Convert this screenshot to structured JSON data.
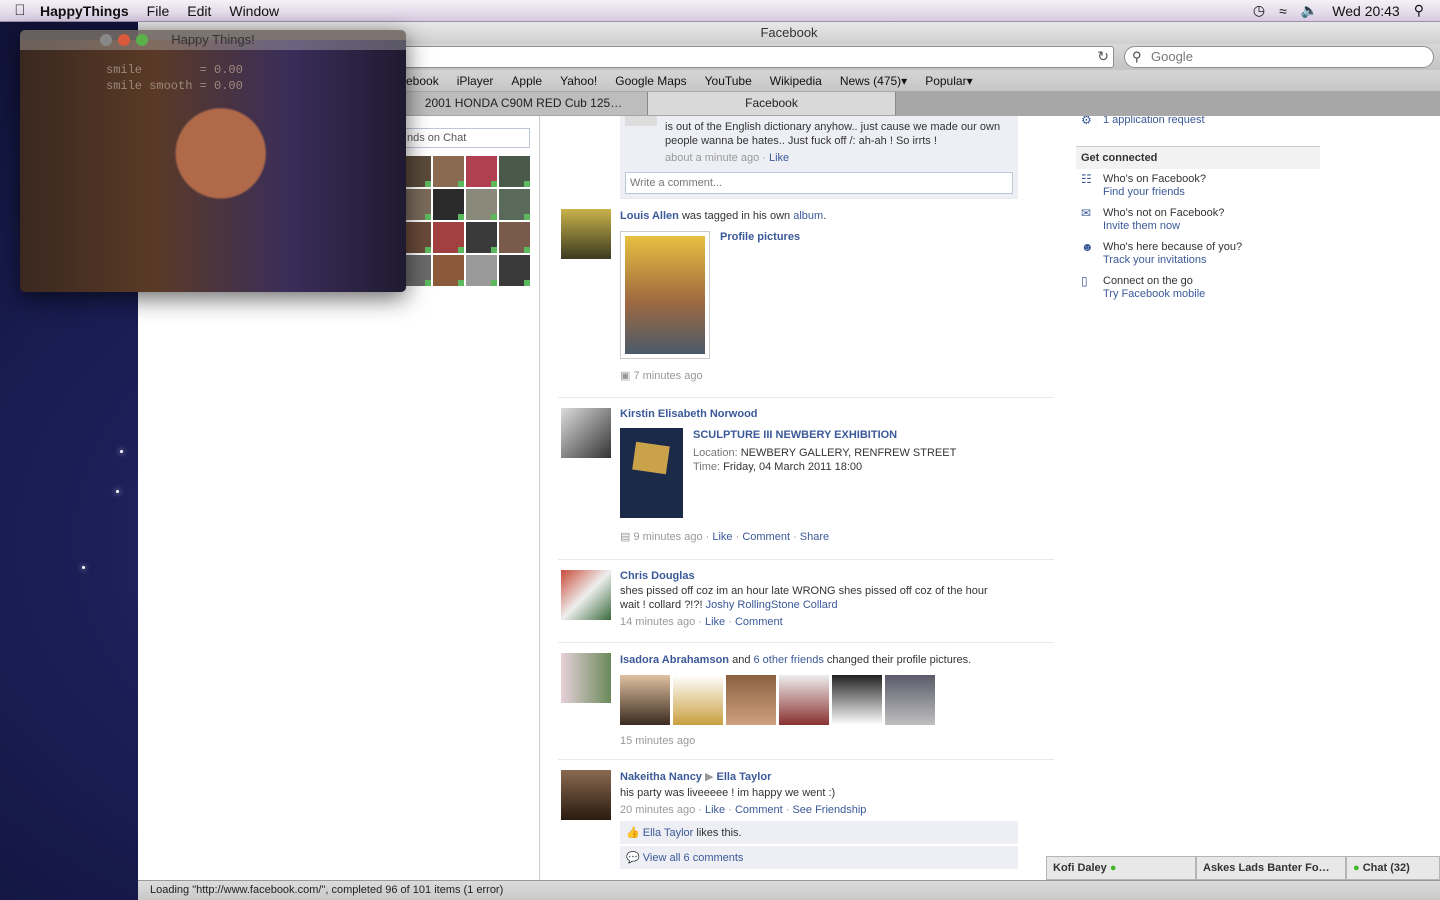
{
  "menubar": {
    "app_name": "HappyThings",
    "menus": [
      "File",
      "Edit",
      "Window"
    ],
    "clock": "Wed 20:43"
  },
  "browser": {
    "title": "Facebook",
    "address": "/",
    "search_placeholder": "Google",
    "bookmarks": [
      "cebook",
      "iPlayer",
      "Apple",
      "Yahoo!",
      "Google Maps",
      "YouTube",
      "Wikipedia",
      "News (475)▾",
      "Popular▾"
    ],
    "tabs": [
      "2001 HONDA C90M RED Cub 125…",
      "Facebook"
    ],
    "status": "Loading \"http://www.facebook.com/\", completed 96 of 101 items (1 error)"
  },
  "happy_things": {
    "title": "Happy Things!",
    "overlay": "smile        = 0.00\nsmile smooth = 0.00"
  },
  "left": {
    "chat_search_placeholder": "nds on Chat"
  },
  "feed": {
    "top_comment": {
      "text": "is out of the English dictionary anyhow.. just cause we made our own people wanna be hates.. Just fuck off /: ah-ah ! So irrts !",
      "time": "about a minute ago",
      "like": "Like",
      "comment_placeholder": "Write a comment..."
    },
    "stories": [
      {
        "actor": "Louis Allen",
        "text": "was tagged in his own",
        "link": "album",
        "after": ".",
        "attachment": "Profile pictures",
        "time": "7 minutes ago"
      },
      {
        "actor": "Kirstin Elisabeth Norwood",
        "event_title": "SCULPTURE III NEWBERY EXHIBITION",
        "location_label": "Location:",
        "location": "NEWBERY GALLERY, RENFREW STREET",
        "time_label": "Time:",
        "event_time": "Friday, 04 March 2011 18:00",
        "time": "9 minutes ago",
        "actions": [
          "Like",
          "Comment",
          "Share"
        ]
      },
      {
        "actor": "Chris Douglas",
        "text": "shes pissed off coz im an hour late WRONG shes pissed off coz of the hour wait ! collard ?!?!",
        "tag": "Joshy RollingStone Collard",
        "time": "14 minutes ago",
        "actions": [
          "Like",
          "Comment"
        ]
      },
      {
        "actor": "Isadora Abrahamson",
        "and": "and",
        "others": "6 other friends",
        "text": "changed their profile pictures.",
        "time": "15 minutes ago"
      },
      {
        "actor": "Nakeitha Nancy",
        "arrow": "▶",
        "target": "Ella Taylor",
        "text": "his party was liveeeee ! im happy we went :)",
        "time": "20 minutes ago",
        "actions": [
          "Like",
          "Comment",
          "See Friendship"
        ],
        "likes_name": "Ella Taylor",
        "likes_text": "likes this.",
        "view_comments": "View all 6 comments"
      }
    ]
  },
  "right": {
    "app_request": "1 application request",
    "heading": "Get connected",
    "items": [
      {
        "title": "Who's on Facebook?",
        "link": "Find your friends"
      },
      {
        "title": "Who's not on Facebook?",
        "link": "Invite them now"
      },
      {
        "title": "Who's here because of you?",
        "link": "Track your invitations"
      },
      {
        "title": "Connect on the go",
        "link": "Try Facebook mobile"
      }
    ]
  },
  "chat_bar": {
    "user": "Kofi Daley",
    "group": "Askes Lads Banter Fo…",
    "chat": "Chat (32)"
  }
}
